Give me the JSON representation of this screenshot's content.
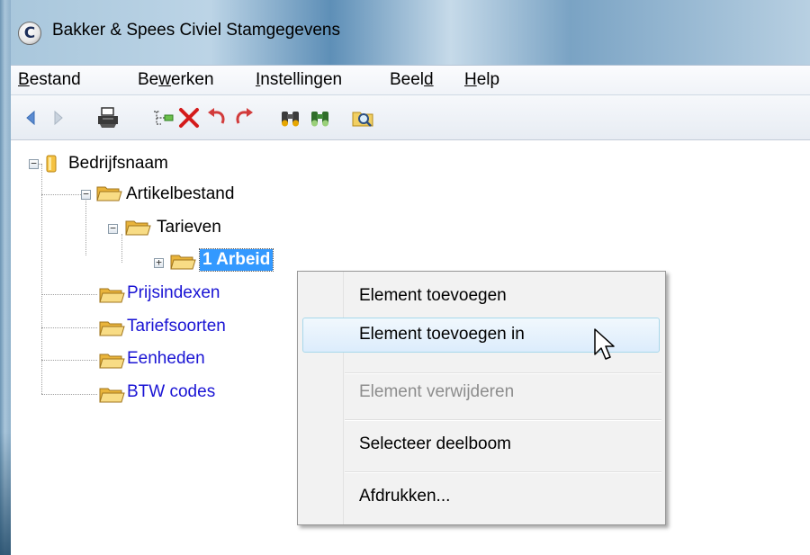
{
  "window": {
    "title": "Bakker & Spees Civiel Stamgegevens",
    "app_icon_letter": "C"
  },
  "menubar": {
    "items": [
      {
        "pre": "",
        "u": "B",
        "post": "estand"
      },
      {
        "pre": "Be",
        "u": "w",
        "post": "erken"
      },
      {
        "pre": "",
        "u": "I",
        "post": "nstellingen"
      },
      {
        "pre": "Beel",
        "u": "d",
        "post": ""
      },
      {
        "pre": "",
        "u": "H",
        "post": "elp"
      }
    ]
  },
  "toolbar": {
    "icons": [
      "back-arrow-icon",
      "forward-arrow-icon",
      "printer-icon",
      "insert-node-icon",
      "delete-x-icon",
      "undo-icon",
      "redo-icon",
      "find-binoculars-icon",
      "find-next-binoculars-icon",
      "magnify-folder-icon"
    ]
  },
  "tree": {
    "root": "Bedrijfsnaam",
    "artikelbestand": "Artikelbestand",
    "tarieven": "Tarieven",
    "arbeid": "1  Arbeid",
    "prijsindexen": "Prijsindexen",
    "tariefsoorten": "Tariefsoorten",
    "eenheden": "Eenheden",
    "btw_codes": "BTW codes",
    "link_color": "#1a14d4",
    "selected_color": "#3399ff"
  },
  "context_menu": {
    "add": "Element toevoegen",
    "add_in": "Element toevoegen in",
    "remove": "Element verwijderen",
    "select_subtree": "Selecteer deelboom",
    "print": "Afdrukken..."
  }
}
